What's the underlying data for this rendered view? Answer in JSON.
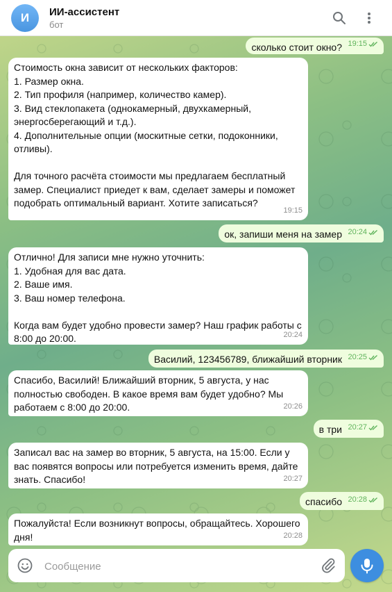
{
  "header": {
    "avatar_letter": "И",
    "title": "ИИ-ассистент",
    "subtitle": "бот",
    "search_icon": "search-icon",
    "more_icon": "more-vertical-icon"
  },
  "messages": [
    {
      "dir": "out",
      "text": "сколько стоит окно?",
      "time": "19:15"
    },
    {
      "dir": "in",
      "text": "Стоимость окна зависит от нескольких факторов:\n1. Размер окна.\n2. Тип профиля (например, количество камер).\n3. Вид стеклопакета (однокамерный, двухкамерный, энергосберегающий и т.д.).\n4. Дополнительные опции (москитные сетки, подоконники, отливы).\n\nДля точного расчёта стоимости мы предлагаем бесплатный замер. Специалист приедет к вам, сделает замеры и поможет подобрать оптимальный вариант. Хотите записаться?",
      "time": "19:15"
    },
    {
      "dir": "out",
      "text": "ок, запиши меня на замер",
      "time": "20:24"
    },
    {
      "dir": "in",
      "text": "Отлично! Для записи мне нужно уточнить:\n1. Удобная для вас дата.\n2. Ваше имя.\n3. Ваш номер телефона.\n\nКогда вам будет удобно провести замер? Наш график работы с 8:00 до 20:00.",
      "time": "20:24"
    },
    {
      "dir": "out",
      "text": "Василий, 123456789, ближайший вторник",
      "time": "20:25"
    },
    {
      "dir": "in",
      "text": "Спасибо, Василий! Ближайший вторник, 5 августа, у нас полностью свободен. В какое время вам будет удобно? Мы работаем с 8:00 до 20:00.",
      "time": "20:26"
    },
    {
      "dir": "out",
      "text": "в три",
      "time": "20:27"
    },
    {
      "dir": "in",
      "text": "Записал вас на замер во вторник, 5 августа, на 15:00. Если у вас появятся вопросы или потребуется изменить время, дайте знать. Спасибо!",
      "time": "20:27"
    },
    {
      "dir": "out",
      "text": "спасибо",
      "time": "20:28"
    },
    {
      "dir": "in",
      "text": "Пожалуйста! Если возникнут вопросы, обращайтесь. Хорошего дня!",
      "time": "20:28"
    }
  ],
  "composer": {
    "placeholder": "Сообщение",
    "emoji_icon": "smile-icon",
    "attach_icon": "paperclip-icon",
    "mic_icon": "microphone-icon"
  },
  "colors": {
    "accent": "#3d8ee0",
    "outgoing_bubble": "#effdde",
    "incoming_bubble": "#ffffff",
    "read_check": "#5fb35b"
  }
}
